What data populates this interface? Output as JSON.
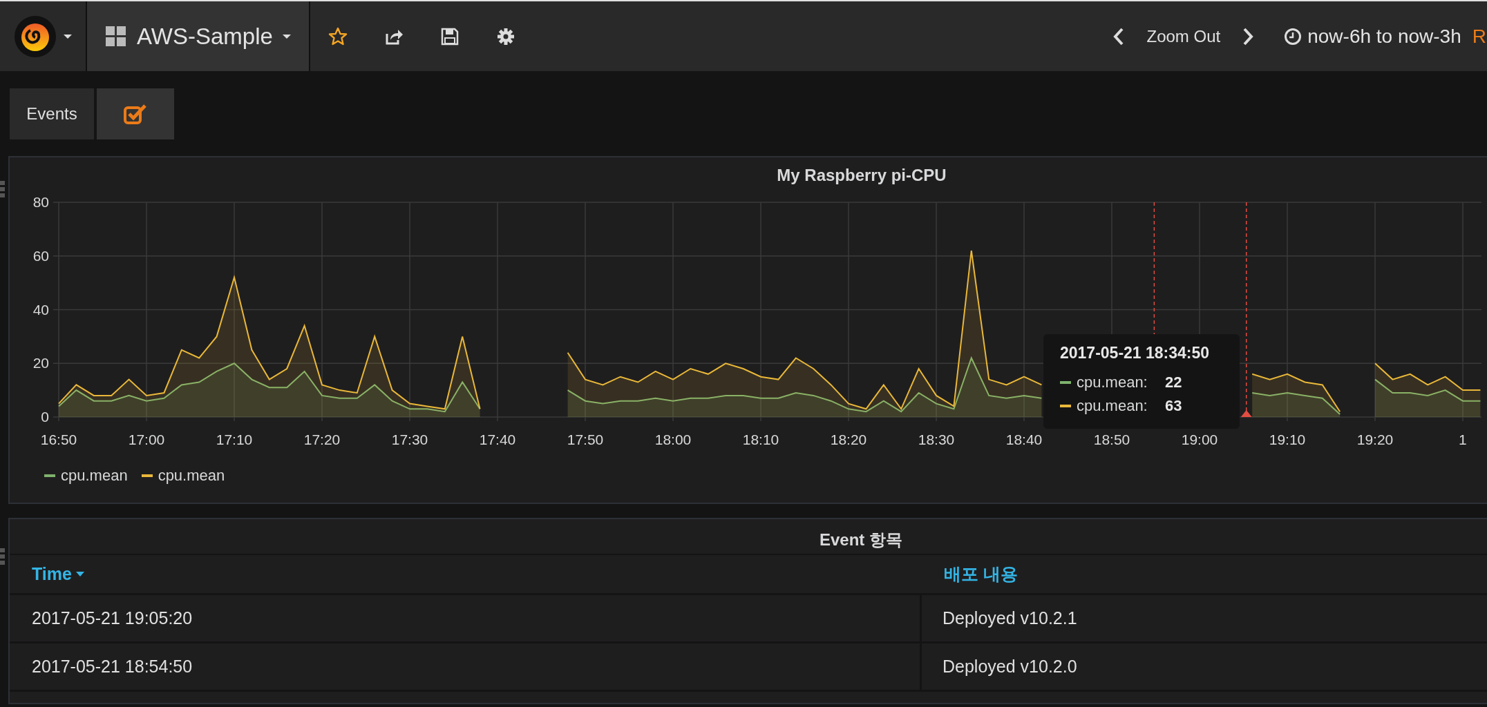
{
  "navbar": {
    "dashboard_title": "AWS-Sample",
    "zoom_label": "Zoom Out",
    "time_range": "now-6h to now-3h",
    "refresh_label": "R"
  },
  "variables": [
    {
      "label": "Events",
      "checked": true
    }
  ],
  "graph_panel": {
    "title": "My Raspberry pi-CPU",
    "chart_data": {
      "type": "area",
      "categories": [
        "16:50",
        null,
        null,
        null,
        null,
        "17:00",
        null,
        null,
        null,
        null,
        "17:10",
        null,
        null,
        null,
        null,
        "17:20",
        null,
        null,
        null,
        null,
        "17:30",
        null,
        null,
        null,
        null,
        "17:40",
        null,
        null,
        null,
        null,
        "17:50",
        null,
        null,
        null,
        null,
        "18:00",
        null,
        null,
        null,
        null,
        "18:10",
        null,
        null,
        null,
        null,
        "18:20",
        null,
        null,
        null,
        null,
        "18:30",
        null,
        null,
        null,
        null,
        "18:40",
        null,
        null,
        null,
        null,
        "18:50",
        null,
        null,
        null,
        null,
        "19:00",
        null,
        null,
        null,
        null,
        "19:10",
        null,
        null,
        null,
        null,
        "19:20",
        null,
        null,
        null,
        null,
        "1",
        null
      ],
      "series": [
        {
          "name": "cpu.mean",
          "color": "#7eb26d",
          "values": [
            4,
            10,
            6,
            6,
            8,
            6,
            7,
            12,
            13,
            17,
            20,
            14,
            11,
            11,
            17,
            8,
            7,
            7,
            12,
            6,
            3,
            3,
            2,
            13,
            3,
            null,
            null,
            null,
            null,
            10,
            6,
            5,
            6,
            6,
            7,
            6,
            7,
            7,
            8,
            8,
            7,
            7,
            9,
            8,
            6,
            3,
            2,
            6,
            2,
            9,
            5,
            3,
            22,
            8,
            7,
            8,
            7,
            null,
            null,
            null,
            null,
            null,
            null,
            null,
            null,
            null,
            null,
            null,
            9,
            8,
            9,
            8,
            7,
            1,
            null,
            14,
            9,
            9,
            8,
            10,
            6,
            6
          ]
        },
        {
          "name": "cpu.mean",
          "color": "#eab839",
          "values": [
            5,
            12,
            8,
            8,
            14,
            8,
            9,
            25,
            22,
            30,
            52,
            25,
            14,
            18,
            34,
            12,
            10,
            9,
            30,
            10,
            5,
            4,
            3,
            30,
            3,
            null,
            null,
            null,
            null,
            24,
            14,
            12,
            15,
            13,
            17,
            14,
            18,
            16,
            20,
            18,
            15,
            14,
            22,
            18,
            12,
            5,
            3,
            12,
            3,
            18,
            8,
            4,
            62,
            14,
            12,
            15,
            12,
            null,
            null,
            null,
            null,
            null,
            null,
            null,
            null,
            null,
            null,
            null,
            16,
            14,
            16,
            13,
            12,
            2,
            null,
            20,
            14,
            16,
            12,
            15,
            10,
            10
          ]
        }
      ],
      "ylim": [
        0,
        80
      ],
      "yticks": [
        0,
        20,
        40,
        60,
        80
      ],
      "grid": true
    },
    "tooltip": {
      "time": "2017-05-21 18:34:50",
      "rows": [
        {
          "label": "cpu.mean:",
          "value": "22"
        },
        {
          "label": "cpu.mean:",
          "value": "63"
        }
      ]
    }
  },
  "table_panel": {
    "title": "Event 항목",
    "columns": [
      {
        "label": "Time",
        "sorted": true
      },
      {
        "label": "배포 내용",
        "sorted": false
      }
    ],
    "rows": [
      [
        "2017-05-21 19:05:20",
        "Deployed v10.2.1"
      ],
      [
        "2017-05-21 18:54:50",
        "Deployed v10.2.0"
      ]
    ]
  }
}
